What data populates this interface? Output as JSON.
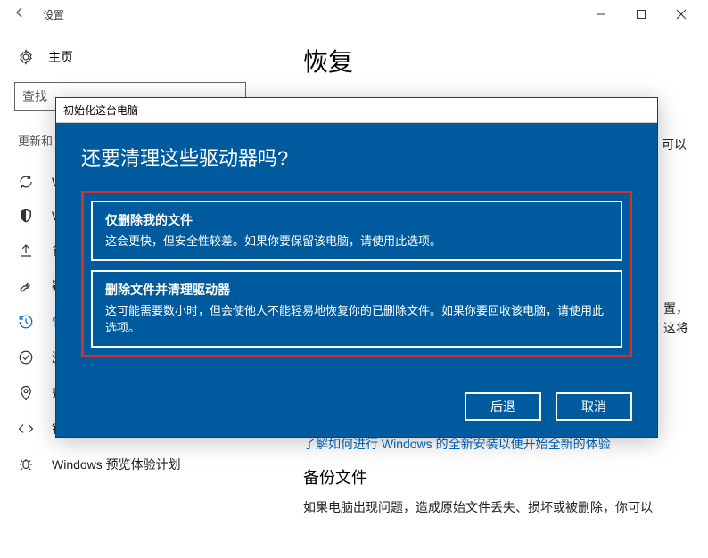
{
  "window": {
    "title": "设置"
  },
  "sidebar": {
    "home": "主页",
    "search_placeholder": "查找",
    "section": "更新和",
    "items": [
      {
        "label": "W"
      },
      {
        "label": "W"
      },
      {
        "label": "备"
      },
      {
        "label": "疑"
      },
      {
        "label": "恢"
      },
      {
        "label": "激"
      },
      {
        "label": "查找我的设备"
      },
      {
        "label": "针对开发人员"
      },
      {
        "label": "Windows 预览体验计划"
      }
    ]
  },
  "main": {
    "heading": "恢复",
    "peek_right1": "可以",
    "peek_right2_a": "置，",
    "peek_right2_b": "这将",
    "link": "了解如何进行 Windows 的全新安装以便开始全新的体验",
    "backup_heading": "备份文件",
    "backup_text": "如果电脑出现问题，造成原始文件丢失、损坏或被删除，你可以"
  },
  "dialog": {
    "titlebar": "初始化这台电脑",
    "question": "还要清理这些驱动器吗?",
    "options": [
      {
        "title": "仅删除我的文件",
        "desc": "这会更快，但安全性较差。如果你要保留该电脑，请使用此选项。"
      },
      {
        "title": "删除文件并清理驱动器",
        "desc": "这可能需要数小时，但会使他人不能轻易地恢复你的已删除文件。如果你要回收该电脑，请使用此选项。"
      }
    ],
    "back": "后退",
    "cancel": "取消"
  }
}
